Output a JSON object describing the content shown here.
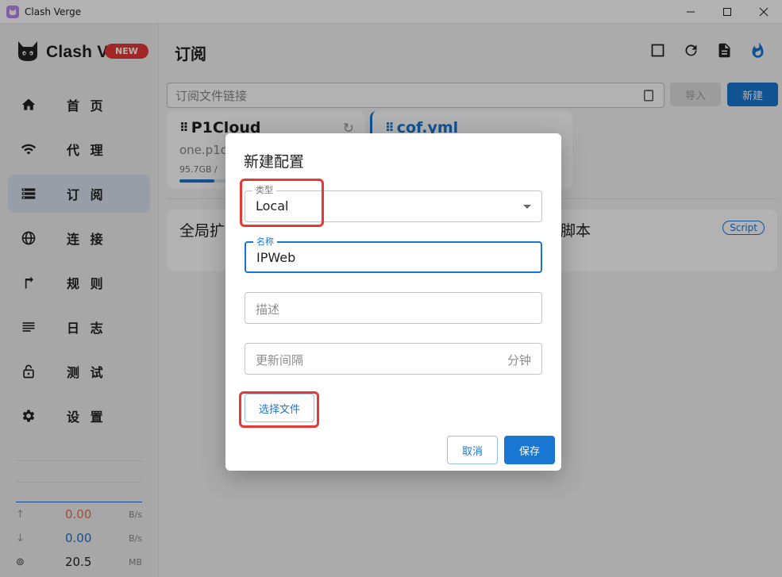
{
  "window": {
    "title": "Clash Verge",
    "icon": "cat-icon",
    "controls": [
      "minimize",
      "maximize",
      "close"
    ]
  },
  "sidebar": {
    "logo_text": "Clash V",
    "logo_badge": "NEW",
    "items": [
      {
        "label": "首 页",
        "icon": "home-icon",
        "active": false
      },
      {
        "label": "代 理",
        "icon": "wifi-icon",
        "active": false
      },
      {
        "label": "订 阅",
        "icon": "storage-icon",
        "active": true
      },
      {
        "label": "连 接",
        "icon": "globe-icon",
        "active": false
      },
      {
        "label": "规 则",
        "icon": "route-icon",
        "active": false
      },
      {
        "label": "日 志",
        "icon": "list-icon",
        "active": false
      },
      {
        "label": "测 试",
        "icon": "lock-icon",
        "active": false
      },
      {
        "label": "设 置",
        "icon": "gear-icon",
        "active": false
      }
    ],
    "traffic": {
      "upload": {
        "value": "0.00",
        "unit": "B/s",
        "color": "#e57350"
      },
      "download": {
        "value": "0.00",
        "unit": "B/s",
        "color": "#1976d2"
      },
      "memory": {
        "value": "20.5",
        "unit": "MB"
      }
    }
  },
  "main": {
    "title": "订阅",
    "url_placeholder": "订阅文件链接",
    "import_label": "导入",
    "new_label": "新建",
    "profiles": [
      {
        "name": "P1Cloud",
        "sub": "one.p1c",
        "usage": "95.7GB /",
        "progress": 0.2
      },
      {
        "name": "cof.yml"
      }
    ],
    "global": {
      "left_text": "全局扩",
      "right_text": "脚本",
      "badge": "Script"
    }
  },
  "dialog": {
    "title": "新建配置",
    "type": {
      "label": "类型",
      "value": "Local"
    },
    "name": {
      "label": "名称",
      "value": "IPWeb"
    },
    "desc": {
      "placeholder": "描述"
    },
    "interval": {
      "placeholder": "更新间隔",
      "unit": "分钟"
    },
    "select_file_label": "选择文件",
    "cancel_label": "取消",
    "save_label": "保存"
  },
  "colors": {
    "accent": "#1976d2",
    "highlight": "#e53935"
  }
}
